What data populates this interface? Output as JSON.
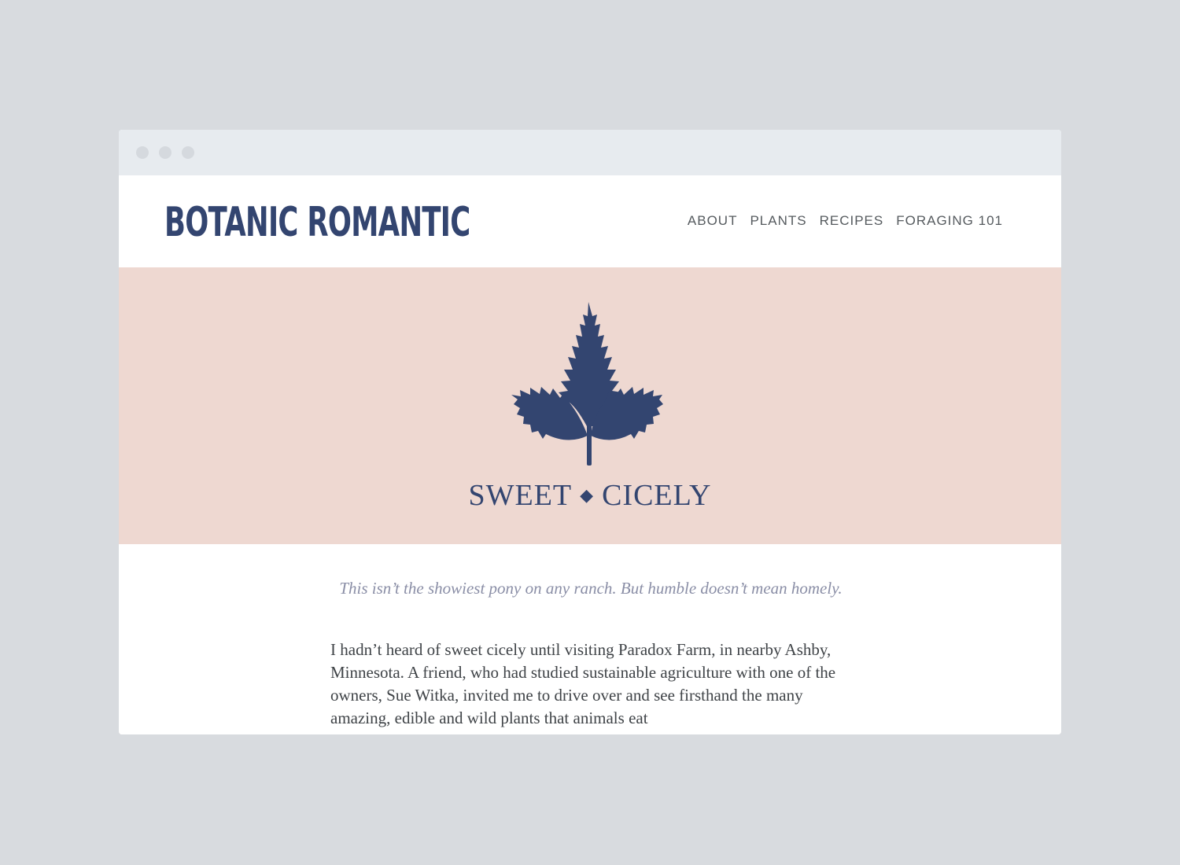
{
  "site": {
    "logo": "BOTANIC ROMANTIC",
    "nav": [
      "ABOUT",
      "PLANTS",
      "RECIPES",
      "FORAGING 101"
    ]
  },
  "hero": {
    "title_left": "SWEET",
    "separator": "◆",
    "title_right": "CICELY",
    "background_color": "#eed8d1",
    "icon": "leaf-icon"
  },
  "article": {
    "lede": "This isn’t the showiest pony on any ranch. But humble doesn’t mean homely.",
    "body": "I hadn’t heard of sweet cicely until visiting Paradox Farm, in nearby Ashby, Minnesota. A friend, who had studied sustainable agriculture with one of the owners, Sue Witka, invited me to drive over and see firsthand the many amazing, edible and wild plants that animals eat"
  },
  "colors": {
    "brand": "#334570",
    "page_background": "#d8dbdf",
    "titlebar": "#e7ebef"
  }
}
